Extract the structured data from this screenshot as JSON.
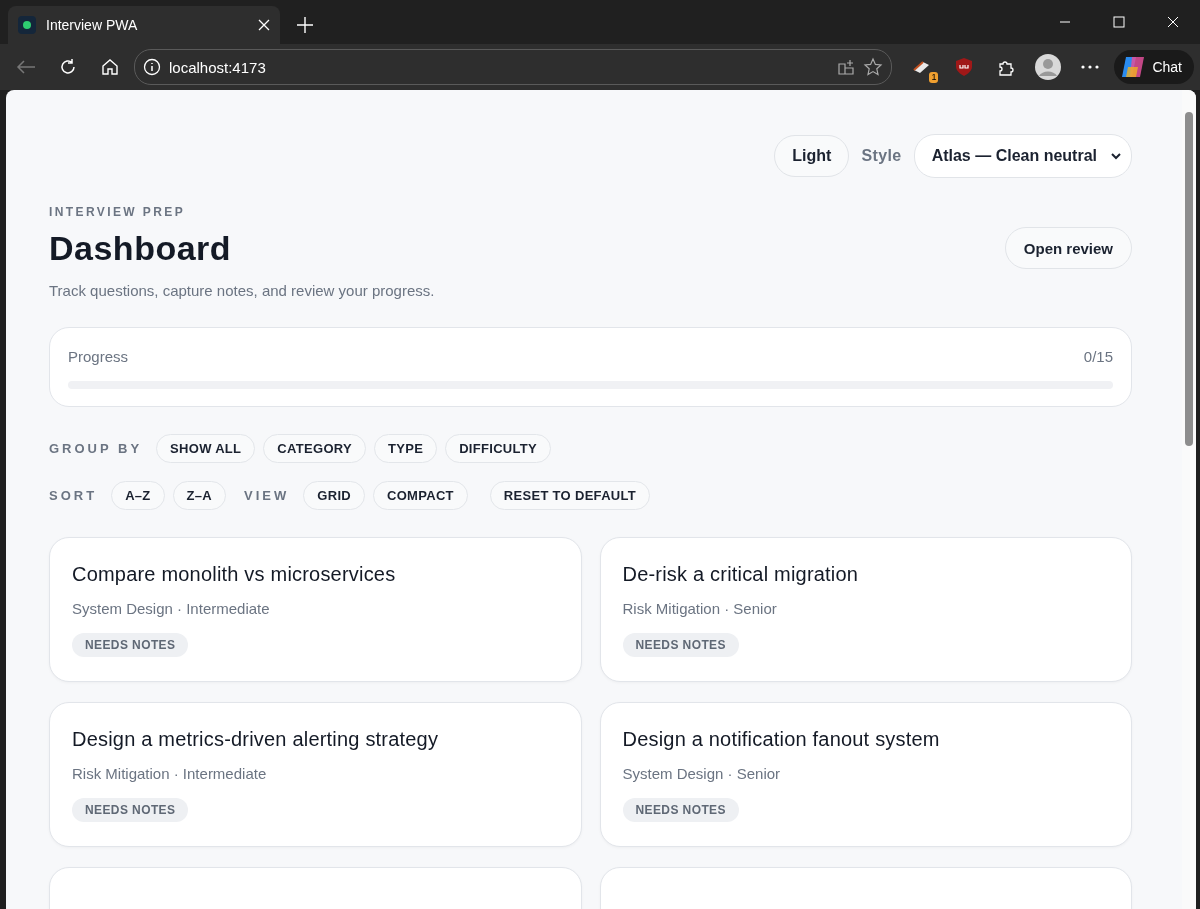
{
  "browser": {
    "tab_title": "Interview PWA",
    "address": "localhost:4173",
    "extension_badge": "1",
    "chat_button": "Chat"
  },
  "header": {
    "theme_button": "Light",
    "style_label": "Style",
    "style_select": "Atlas — Clean neutral",
    "eyebrow": "INTERVIEW PREP",
    "title": "Dashboard",
    "subtitle": "Track questions, capture notes, and review your progress.",
    "review_button": "Open review"
  },
  "progress": {
    "label": "Progress",
    "count": "0/15",
    "level": 0
  },
  "group_by": {
    "label": "GROUP BY",
    "options": [
      "SHOW ALL",
      "CATEGORY",
      "TYPE",
      "DIFFICULTY"
    ]
  },
  "sort": {
    "label": "SORT",
    "options": [
      "A–Z",
      "Z–A"
    ]
  },
  "view": {
    "label": "VIEW",
    "options": [
      "GRID",
      "COMPACT"
    ]
  },
  "reset_button": "RESET TO DEFAULT",
  "cards": [
    {
      "kind": "full",
      "title": "Compare monolith vs microservices",
      "meta": "System Design · Intermediate",
      "tag": "NEEDS NOTES"
    },
    {
      "kind": "full",
      "title": "De-risk a critical migration",
      "meta": "Risk Mitigation · Senior",
      "tag": "NEEDS NOTES"
    },
    {
      "kind": "full",
      "title": "Design a metrics-driven alerting strategy",
      "meta": "Risk Mitigation · Intermediate",
      "tag": "NEEDS NOTES"
    },
    {
      "kind": "full",
      "title": "Design a notification fanout system",
      "meta": "System Design · Senior",
      "tag": "NEEDS NOTES"
    },
    {
      "kind": "clipped"
    },
    {
      "kind": "clipped"
    }
  ]
}
